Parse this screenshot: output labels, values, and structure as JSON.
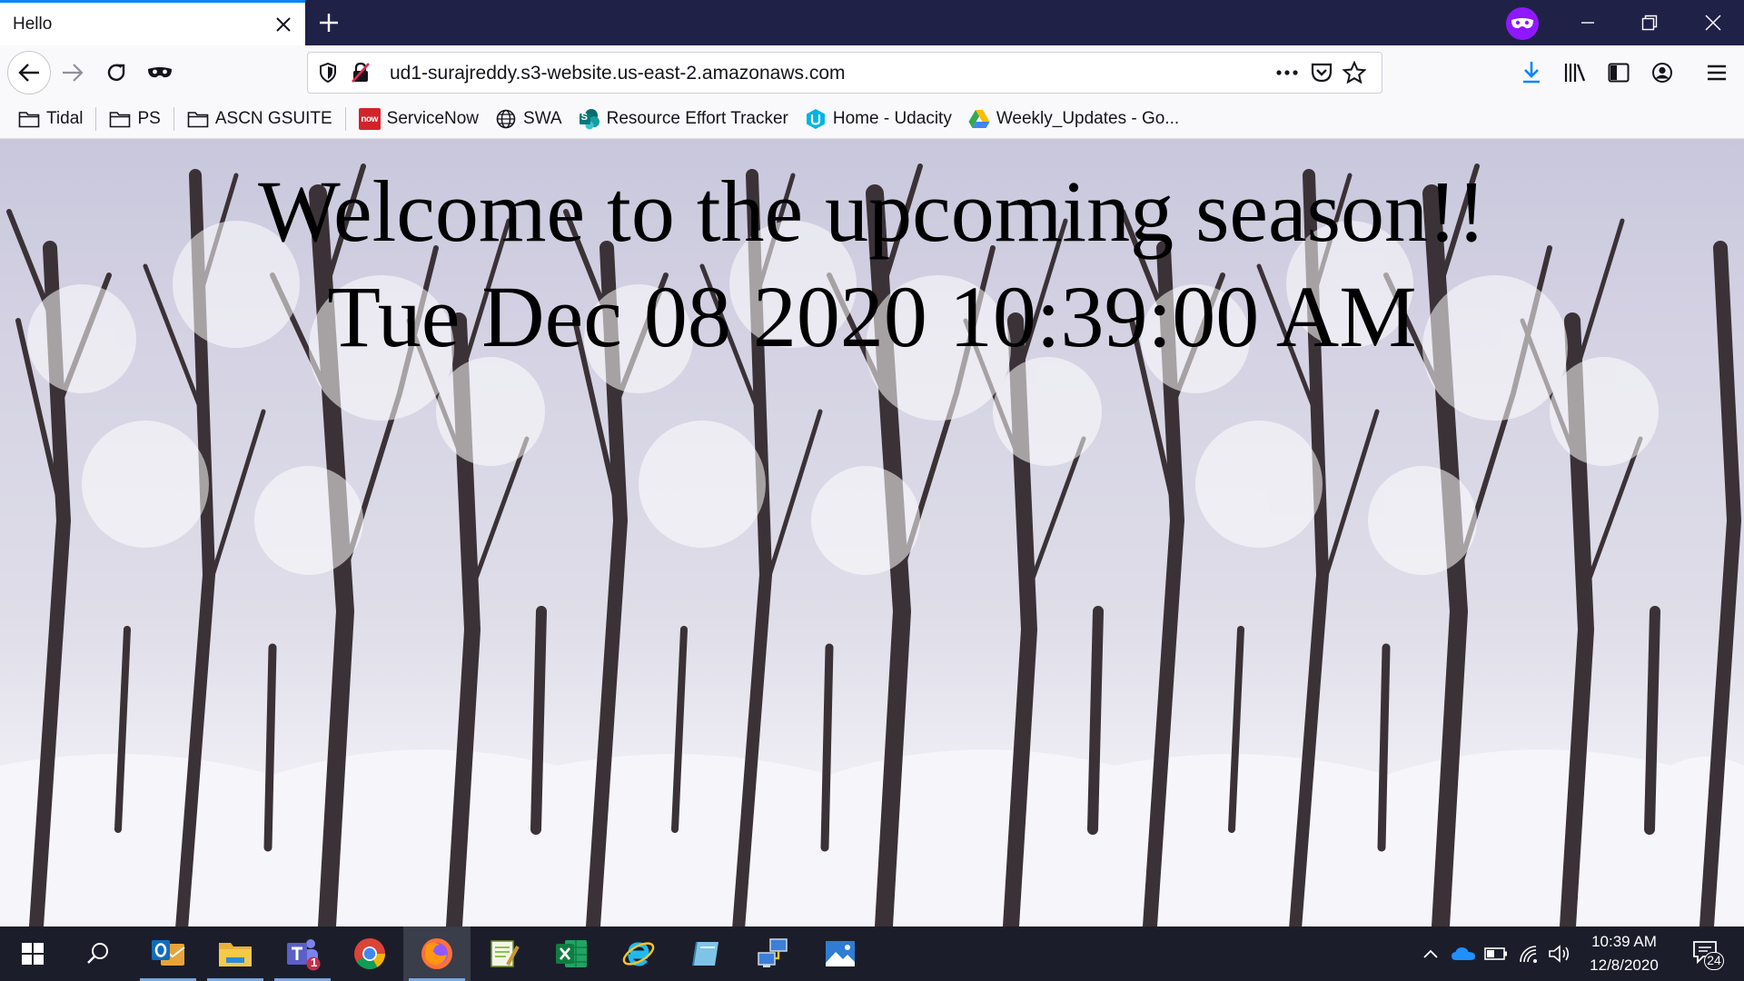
{
  "browser": {
    "tab": {
      "title": "Hello"
    },
    "url": "ud1-surajreddy.s3-website.us-east-2.amazonaws.com"
  },
  "bookmarks": [
    {
      "label": "Tidal",
      "icon": "folder-icon"
    },
    {
      "label": "PS",
      "icon": "folder-icon"
    },
    {
      "label": "ASCN GSUITE",
      "icon": "folder-icon"
    },
    {
      "label": "ServiceNow",
      "icon": "servicenow-icon",
      "icon_text": "now"
    },
    {
      "label": "SWA",
      "icon": "globe-icon"
    },
    {
      "label": "Resource Effort Tracker",
      "icon": "sharepoint-icon",
      "icon_text": "S"
    },
    {
      "label": "Home - Udacity",
      "icon": "udacity-icon"
    },
    {
      "label": "Weekly_Updates - Go...",
      "icon": "google-drive-icon"
    }
  ],
  "page": {
    "heading": "Welcome to the upcoming season!!",
    "datetime": "Tue Dec 08 2020 10:39:00 AM"
  },
  "taskbar": {
    "apps": [
      {
        "name": "outlook-icon",
        "color": "#0f6cbd"
      },
      {
        "name": "file-explorer-icon",
        "color": "#f7c948"
      },
      {
        "name": "teams-icon",
        "color": "#5b5fc7",
        "badge": "1"
      },
      {
        "name": "chrome-icon",
        "color": "#34a853"
      },
      {
        "name": "firefox-icon",
        "color": "#ff7139"
      },
      {
        "name": "notepad-plus-plus-icon",
        "color": "#8bc34a"
      },
      {
        "name": "excel-icon",
        "color": "#107c41"
      },
      {
        "name": "internet-explorer-icon",
        "color": "#1ebbee"
      },
      {
        "name": "app-icon",
        "color": "#7fc4e6"
      },
      {
        "name": "remote-desktop-icon",
        "color": "#3c7fd6"
      },
      {
        "name": "photos-icon",
        "color": "#2f7dd3"
      }
    ],
    "clock": {
      "time": "10:39 AM",
      "date": "12/8/2020"
    },
    "notification_count": "24"
  },
  "colors": {
    "tabstrip": "#1f2147",
    "accent": "#0a84ff",
    "private_mask": "#8f18ff",
    "download_arrow": "#0a84ff",
    "taskbar": "#1b1e2a"
  }
}
